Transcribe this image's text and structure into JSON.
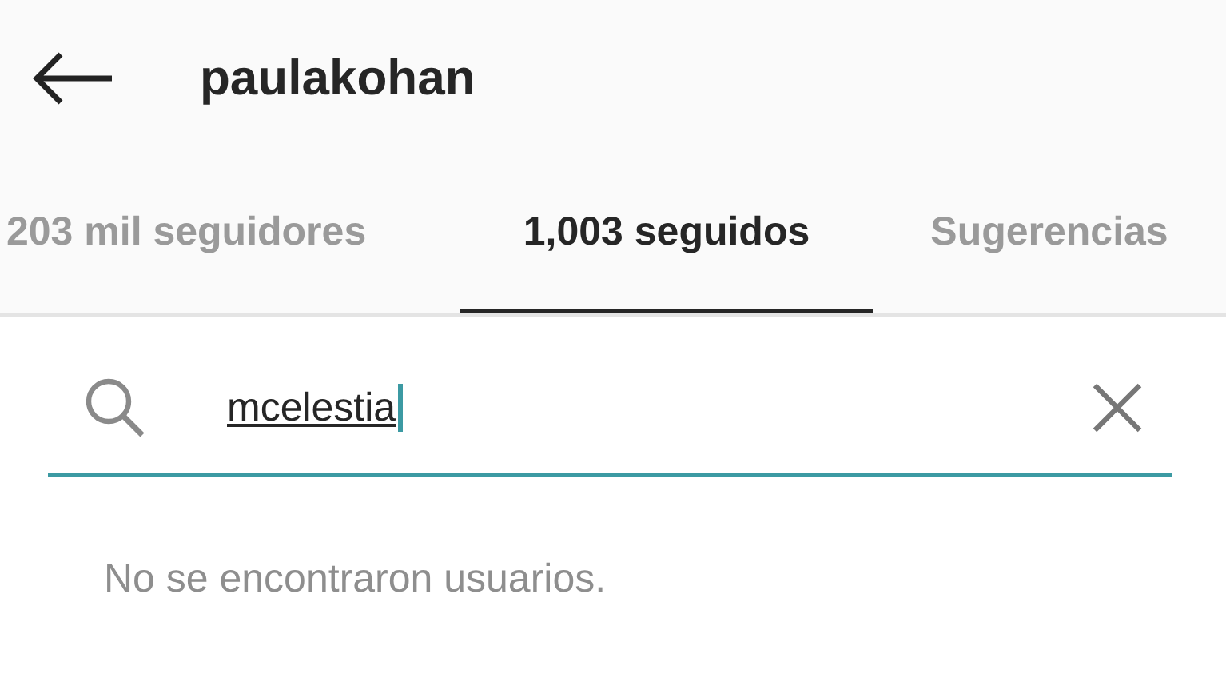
{
  "header": {
    "title": "paulakohan"
  },
  "tabs": [
    {
      "label": "203 mil seguidores",
      "selected": false
    },
    {
      "label": "1,003 seguidos",
      "selected": true
    },
    {
      "label": "Sugerencias",
      "selected": false
    }
  ],
  "search": {
    "value": "mcelestia"
  },
  "message": "No se encontraron usuarios."
}
